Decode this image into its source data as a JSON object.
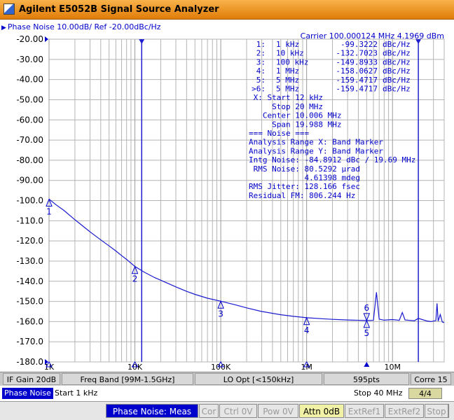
{
  "window": {
    "title": "Agilent E5052B Signal Source Analyzer"
  },
  "trace": {
    "title": "Phase Noise 10.00dB/ Ref -20.00dBc/Hz",
    "carrier": "Carrier 100.000124 MHz    4.1969 dBm"
  },
  "marker_table": [
    {
      "id": "1:",
      "freq": "1 kHz",
      "value": "-99.3222",
      "unit": "dBc/Hz"
    },
    {
      "id": "2:",
      "freq": "10 kHz",
      "value": "-132.7023",
      "unit": "dBc/Hz"
    },
    {
      "id": "3:",
      "freq": "100 kHz",
      "value": "-149.8933",
      "unit": "dBc/Hz"
    },
    {
      "id": "4:",
      "freq": "1 MHz",
      "value": "-158.0627",
      "unit": "dBc/Hz"
    },
    {
      "id": "5:",
      "freq": "5 MHz",
      "value": "-159.4717",
      "unit": "dBc/Hz"
    },
    {
      "id": ">6:",
      "freq": "5 MHz",
      "value": "-159.4717",
      "unit": "dBc/Hz"
    }
  ],
  "analysis_lines": [
    " X: Start 12 kHz",
    "     Stop 20 MHz",
    "   Center 10.006 MHz",
    "     Span 19.988 MHz",
    "=== Noise ===",
    "Analysis Range X: Band Marker",
    "Analysis Range Y: Band Marker",
    "Intg Noise: -84.8912 dBc / 19.69 MHz",
    " RMS Noise: 80.5292 µrad",
    "            4.61398 mdeg",
    "RMS Jitter: 128.166 fsec",
    "Residual FM: 806.244 Hz"
  ],
  "y_ticks": [
    "-20.00",
    "-30.00",
    "-40.00",
    "-50.00",
    "-60.00",
    "-70.00",
    "-80.00",
    "-90.00",
    "-100.0",
    "-110.0",
    "-120.0",
    "-130.0",
    "-140.0",
    "-150.0",
    "-160.0",
    "-170.0",
    "-180.0"
  ],
  "x_ticks": [
    "1K",
    "10K",
    "100K",
    "1M",
    "10M"
  ],
  "marker_labels": [
    "1",
    "2",
    "3",
    "4",
    "5",
    "6"
  ],
  "colors": {
    "trace": "#1a1ad0",
    "text": "#0000cc",
    "grid": "#b4b4b4",
    "title_bar": "#f0a030"
  },
  "status_bar_1": {
    "if_gain": "IF Gain 20dB",
    "freq_band": "Freq Band [99M-1.5GHz]",
    "lo_opt": "LO Opt [<150kHz]",
    "points": "595pts",
    "corr": "Corre 15"
  },
  "status_bar_2": {
    "channel": "Phase Noise",
    "start": "Start 1 kHz",
    "stop": "Stop 40 MHz",
    "avg": "4/4"
  },
  "status_bar_3": {
    "meas": "Phase Noise: Meas",
    "cor": "Cor",
    "ctrl": "Ctrl   0V",
    "pow": "Pow   0V",
    "attn": "Attn 0dB",
    "extref1": "ExtRef1",
    "extref2": "ExtRef2",
    "stop": "Stop"
  },
  "chart_data": {
    "type": "line",
    "xscale": "log",
    "xlim": [
      1000,
      40000000
    ],
    "ylim": [
      -180,
      -20
    ],
    "ylabel": "",
    "xlabel": "",
    "series": [
      {
        "points": [
          [
            1000,
            -99.3
          ],
          [
            1200,
            -102.0
          ],
          [
            1500,
            -105.0
          ],
          [
            2000,
            -109.5
          ],
          [
            2500,
            -112.8
          ],
          [
            3000,
            -115.5
          ],
          [
            4000,
            -119.5
          ],
          [
            5000,
            -122.5
          ],
          [
            6000,
            -125.0
          ],
          [
            7000,
            -127.3
          ],
          [
            8000,
            -129.2
          ],
          [
            10000,
            -132.7
          ],
          [
            13000,
            -135.6
          ],
          [
            17000,
            -138.2
          ],
          [
            20000,
            -139.5
          ],
          [
            30000,
            -142.8
          ],
          [
            40000,
            -145.0
          ],
          [
            50000,
            -146.5
          ],
          [
            70000,
            -148.4
          ],
          [
            100000,
            -149.9
          ],
          [
            150000,
            -151.8
          ],
          [
            200000,
            -153.2
          ],
          [
            300000,
            -155.0
          ],
          [
            500000,
            -156.6
          ],
          [
            700000,
            -157.4
          ],
          [
            1000000,
            -158.1
          ],
          [
            1500000,
            -158.6
          ],
          [
            2000000,
            -158.9
          ],
          [
            3000000,
            -159.2
          ],
          [
            5000000,
            -159.5
          ],
          [
            6000000,
            -159.4
          ],
          [
            6500000,
            -145.5
          ],
          [
            7000000,
            -158.8
          ],
          [
            8000000,
            -159.3
          ],
          [
            10000000,
            -159.0
          ],
          [
            12000000,
            -159.4
          ],
          [
            13000000,
            -155.5
          ],
          [
            14000000,
            -159.2
          ],
          [
            18000000,
            -159.6
          ],
          [
            20000000,
            -158.4
          ],
          [
            25000000,
            -159.7
          ],
          [
            28000000,
            -160.0
          ],
          [
            32000000,
            -159.5
          ],
          [
            33000000,
            -151.0
          ],
          [
            34000000,
            -159.8
          ],
          [
            36000000,
            -156.5
          ],
          [
            38000000,
            -160.2
          ],
          [
            40000000,
            -160.5
          ]
        ]
      }
    ],
    "markers": [
      {
        "label": "1",
        "x": 1000,
        "y": -99.3222
      },
      {
        "label": "2",
        "x": 10000,
        "y": -132.7023
      },
      {
        "label": "3",
        "x": 100000,
        "y": -149.8933
      },
      {
        "label": "4",
        "x": 1000000,
        "y": -158.0627
      },
      {
        "label": "5",
        "x": 5000000,
        "y": -159.4717
      },
      {
        "label": "6",
        "x": 5000000,
        "y": -159.4717
      }
    ],
    "band_markers": [
      12000,
      20000000
    ]
  }
}
